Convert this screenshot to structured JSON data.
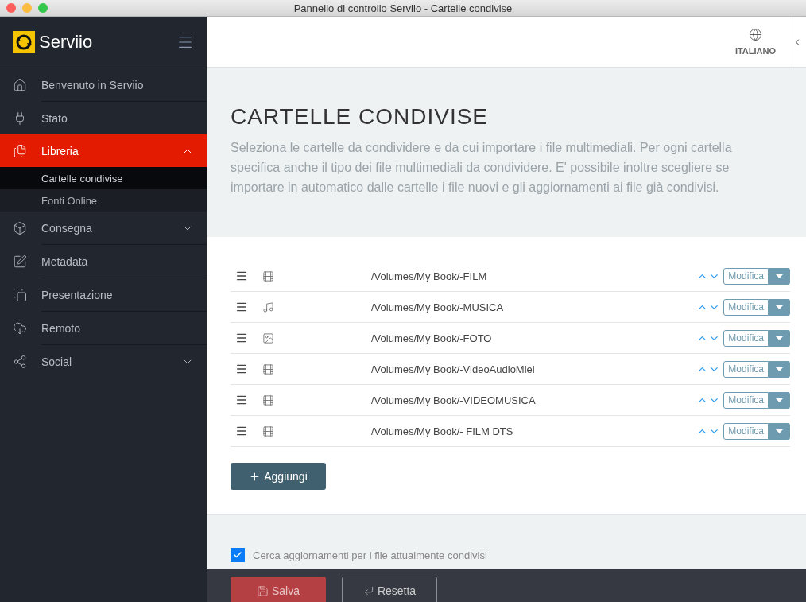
{
  "window": {
    "title": "Pannello di controllo Serviio - Cartelle condivise"
  },
  "brand": {
    "name": "Serviio"
  },
  "sidebar": {
    "items": [
      {
        "kind": "home",
        "label": "Benvenuto in Serviio",
        "selected": false
      },
      {
        "kind": "plug",
        "label": "Stato",
        "selected": false
      },
      {
        "kind": "files",
        "label": "Libreria",
        "selected": true,
        "expanded": true,
        "children": [
          {
            "label": "Cartelle condivise",
            "selected": true
          },
          {
            "label": "Fonti Online",
            "selected": false
          }
        ]
      },
      {
        "kind": "box",
        "label": "Consegna",
        "selected": false,
        "expanded": false
      },
      {
        "kind": "edit",
        "label": "Metadata",
        "selected": false
      },
      {
        "kind": "copy",
        "label": "Presentazione",
        "selected": false
      },
      {
        "kind": "cloud",
        "label": "Remoto",
        "selected": false
      },
      {
        "kind": "share",
        "label": "Social",
        "selected": false,
        "expanded": false
      }
    ]
  },
  "header": {
    "language": "ITALIANO"
  },
  "page": {
    "title": "CARTELLE CONDIVISE",
    "description": "Seleziona le cartelle da condividere e da cui importare i file multimediali. Per ogni cartella specifica anche il tipo dei file multimediali da condividere. E' possibile inoltre scegliere se importare in automatico dalle cartelle i file nuovi e gli aggiornamenti ai file già condivisi."
  },
  "folders": [
    {
      "kind": "film",
      "path": "/Volumes/My Book/-FILM",
      "action": "Modifica"
    },
    {
      "kind": "music",
      "path": "/Volumes/My Book/-MUSICA",
      "action": "Modifica"
    },
    {
      "kind": "image",
      "path": "/Volumes/My Book/-FOTO",
      "action": "Modifica"
    },
    {
      "kind": "film",
      "path": "/Volumes/My Book/-VideoAudioMiei",
      "action": "Modifica"
    },
    {
      "kind": "film",
      "path": "/Volumes/My Book/-VIDEOMUSICA",
      "action": "Modifica"
    },
    {
      "kind": "film",
      "path": "/Volumes/My Book/- FILM DTS",
      "action": "Modifica"
    }
  ],
  "add_button": "Aggiungi",
  "options": [
    {
      "label": "Cerca aggiornamenti per i file attualmente condivisi",
      "checked": true
    }
  ],
  "footer": {
    "save": "Salva",
    "reset": "Resetta"
  }
}
